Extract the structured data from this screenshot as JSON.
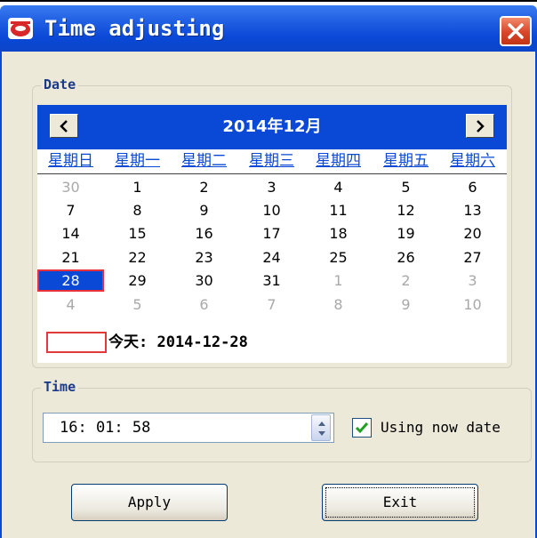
{
  "window": {
    "title": "Time adjusting"
  },
  "date_group": {
    "label": "Date"
  },
  "calendar": {
    "month_label": "2014年12月",
    "weekdays": [
      "星期日",
      "星期一",
      "星期二",
      "星期三",
      "星期四",
      "星期五",
      "星期六"
    ],
    "weeks": [
      [
        {
          "d": "30",
          "o": true
        },
        {
          "d": "1"
        },
        {
          "d": "2"
        },
        {
          "d": "3"
        },
        {
          "d": "4"
        },
        {
          "d": "5"
        },
        {
          "d": "6"
        }
      ],
      [
        {
          "d": "7"
        },
        {
          "d": "8"
        },
        {
          "d": "9"
        },
        {
          "d": "10"
        },
        {
          "d": "11"
        },
        {
          "d": "12"
        },
        {
          "d": "13"
        }
      ],
      [
        {
          "d": "14"
        },
        {
          "d": "15"
        },
        {
          "d": "16"
        },
        {
          "d": "17"
        },
        {
          "d": "18"
        },
        {
          "d": "19"
        },
        {
          "d": "20"
        }
      ],
      [
        {
          "d": "21"
        },
        {
          "d": "22"
        },
        {
          "d": "23"
        },
        {
          "d": "24"
        },
        {
          "d": "25"
        },
        {
          "d": "26"
        },
        {
          "d": "27"
        }
      ],
      [
        {
          "d": "28",
          "s": true
        },
        {
          "d": "29"
        },
        {
          "d": "30"
        },
        {
          "d": "31"
        },
        {
          "d": "1",
          "o": true
        },
        {
          "d": "2",
          "o": true
        },
        {
          "d": "3",
          "o": true
        }
      ],
      [
        {
          "d": "4",
          "o": true
        },
        {
          "d": "5",
          "o": true
        },
        {
          "d": "6",
          "o": true
        },
        {
          "d": "7",
          "o": true
        },
        {
          "d": "8",
          "o": true
        },
        {
          "d": "9",
          "o": true
        },
        {
          "d": "10",
          "o": true
        }
      ]
    ],
    "today_text": "今天: 2014-12-28"
  },
  "time_group": {
    "label": "Time",
    "value": "16: 01: 58",
    "checkbox_label": "Using now date",
    "checkbox_checked": true
  },
  "buttons": {
    "apply": "Apply",
    "exit": "Exit"
  },
  "colors": {
    "titlebar": "#0a48d6",
    "calendar_header": "#0a48d6",
    "selected_day": "#0a48d6",
    "selection_border": "#e8303a",
    "window_background": "#ece9d8"
  },
  "icons": {
    "app": "app-icon",
    "close": "close-icon",
    "prev_month": "chevron-left-icon",
    "next_month": "chevron-right-icon",
    "spinner": "spinner-icon",
    "check": "checkmark-icon"
  }
}
